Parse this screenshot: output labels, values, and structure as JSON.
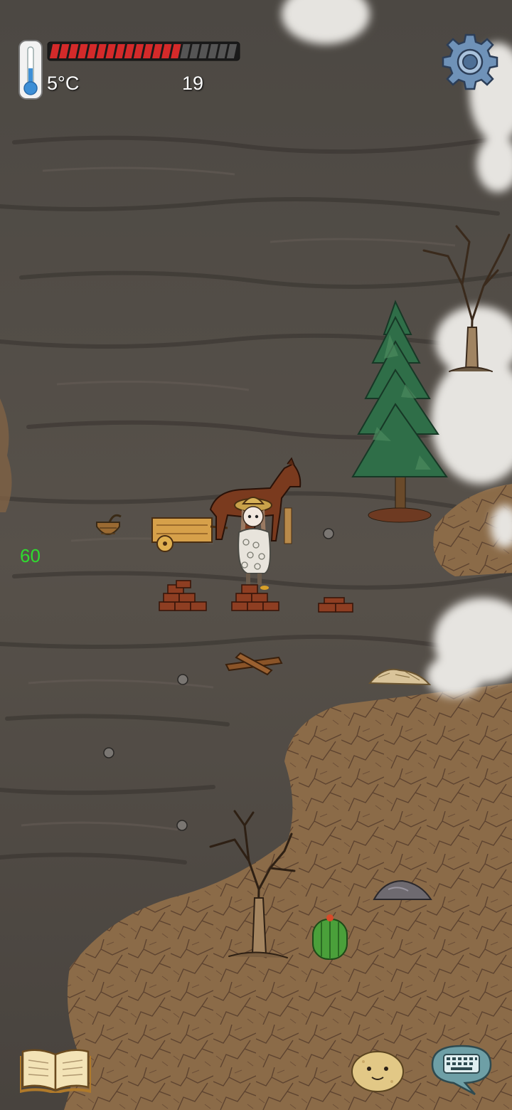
{
  "hud": {
    "temperature": "5°C",
    "counter": "19",
    "health_fraction": 0.7,
    "health_segments": 20,
    "icons": {
      "thermometer": "thermometer-icon",
      "settings": "gear-icon"
    }
  },
  "debug": {
    "fps": "60"
  },
  "bottom_bar": {
    "icons": {
      "book": "book-icon",
      "emote": "face-icon",
      "chat": "keyboard-chat-icon"
    }
  },
  "colors": {
    "health_fill": "#d42a2a",
    "health_empty": "#555555",
    "gear": "#6f92b8",
    "fps_text": "#2fdc2f",
    "chat_bubble": "#6e9fa6",
    "stone_ground": "#4a4540",
    "dirt_ground": "#8a6a48",
    "fog": "#e4e2de"
  },
  "world_objects": [
    "bare-tree",
    "pine-tree",
    "horse-cart",
    "player-character",
    "basket",
    "brick-stack",
    "firewood",
    "rock",
    "flint-stone",
    "cactus",
    "straw-pile"
  ]
}
